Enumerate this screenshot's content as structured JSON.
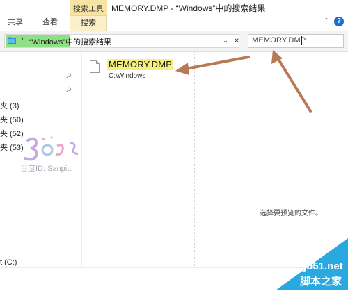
{
  "window": {
    "title": "MEMORY.DMP - “Windows”中的搜索结果",
    "minimize_glyph": "—"
  },
  "ribbon": {
    "context_header": "搜索工具",
    "tabs": [
      {
        "label": "共享"
      },
      {
        "label": "查看"
      },
      {
        "label": "搜索",
        "active": true
      }
    ],
    "collapse_glyph": "⌃",
    "help_glyph": "?"
  },
  "address_bar": {
    "separator": "›",
    "path": "“Windows”中的搜索结果",
    "dropdown_glyph": "⌄",
    "close_glyph": "×",
    "highlight_color": "#8de085"
  },
  "search": {
    "value": "MEMORY.DMP"
  },
  "nav": {
    "items": [
      {
        "label": "夹 (3)"
      },
      {
        "label": "夹 (50)"
      },
      {
        "label": "夹 (52)"
      },
      {
        "label": "夹 (53)"
      }
    ],
    "drive": "t (C:)",
    "pin_glyph": "📌"
  },
  "results": [
    {
      "name": "MEMORY.DMP",
      "path": "C:\\Windows",
      "highlight_color": "#f4f07a"
    }
  ],
  "preview": {
    "message": "选择要预览的文件。"
  },
  "watermark": {
    "text": "百度ID: Sanpitt"
  },
  "site_logo": {
    "domain": "jb51.net",
    "name": "脚本之家",
    "color": "#2aa8e0"
  },
  "annotations": {
    "arrow_color": "#b87a55"
  }
}
